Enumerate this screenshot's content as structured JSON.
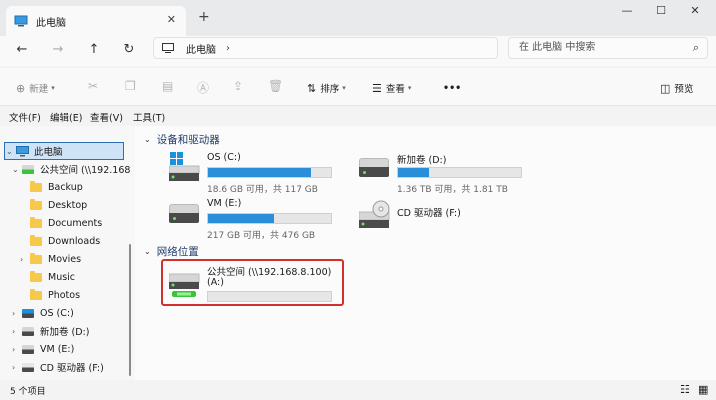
{
  "window": {
    "tab_title": "此电脑",
    "new_tab": "+",
    "close_tab": "✕",
    "controls": {
      "minimize": "—",
      "maximize": "☐",
      "close": "✕"
    }
  },
  "nav_buttons": {
    "back": "←",
    "forward": "→",
    "up": "↑",
    "refresh": "↻"
  },
  "address": {
    "path": "此电脑",
    "chevron": "›"
  },
  "search": {
    "placeholder": "在 此电脑 中搜索"
  },
  "command_bar": {
    "new": "新建",
    "sort": "排序",
    "view": "查看",
    "more": "•••",
    "preview": "预览"
  },
  "menu": [
    "文件(F)",
    "编辑(E)",
    "查看(V)",
    "工具(T)"
  ],
  "nav_pane": {
    "this_pc": "此电脑",
    "items": [
      {
        "label": "公共空间 (\\\\192.168",
        "type": "net",
        "indent": 1,
        "chevron": "⌄"
      },
      {
        "label": "Backup",
        "type": "folder",
        "indent": 2,
        "chevron": ""
      },
      {
        "label": "Desktop",
        "type": "folder",
        "indent": 2,
        "chevron": ""
      },
      {
        "label": "Documents",
        "type": "folder",
        "indent": 2,
        "chevron": ""
      },
      {
        "label": "Downloads",
        "type": "folder",
        "indent": 2,
        "chevron": ""
      },
      {
        "label": "Movies",
        "type": "folder",
        "indent": 2,
        "chevron": "›"
      },
      {
        "label": "Music",
        "type": "folder",
        "indent": 2,
        "chevron": ""
      },
      {
        "label": "Photos",
        "type": "folder",
        "indent": 2,
        "chevron": ""
      },
      {
        "label": "OS (C:)",
        "type": "os",
        "indent": 1,
        "chevron": "›"
      },
      {
        "label": "新加卷 (D:)",
        "type": "drive",
        "indent": 1,
        "chevron": "›"
      },
      {
        "label": "VM (E:)",
        "type": "drive",
        "indent": 1,
        "chevron": "›"
      },
      {
        "label": "CD 驱动器 (F:)",
        "type": "cd",
        "indent": 1,
        "chevron": "›"
      }
    ]
  },
  "groups": {
    "devices": "设备和驱动器",
    "network": "网络位置"
  },
  "drives": [
    {
      "name": "OS (C:)",
      "sub": "18.6 GB 可用，共 117 GB",
      "used_fraction": 0.84,
      "icon": "windows-drive-icon"
    },
    {
      "name": "新加卷 (D:)",
      "sub": "1.36 TB 可用，共 1.81 TB",
      "used_fraction": 0.25,
      "icon": "hard-drive-icon"
    },
    {
      "name": "VM (E:)",
      "sub": "217 GB 可用，共 476 GB",
      "used_fraction": 0.54,
      "icon": "hard-drive-icon"
    },
    {
      "name": "CD 驱动器 (F:)",
      "sub": "",
      "used_fraction": null,
      "icon": "cd-drive-icon"
    }
  ],
  "network_location": {
    "name": "公共空间 (\\\\192.168.8.100)",
    "letter": "(A:)",
    "used_fraction": 0.0
  },
  "status": {
    "items": "5 个项目"
  },
  "colors": {
    "accent": "#2a8fd8",
    "highlight": "#d0312d",
    "selection": "#cfe3f6"
  }
}
